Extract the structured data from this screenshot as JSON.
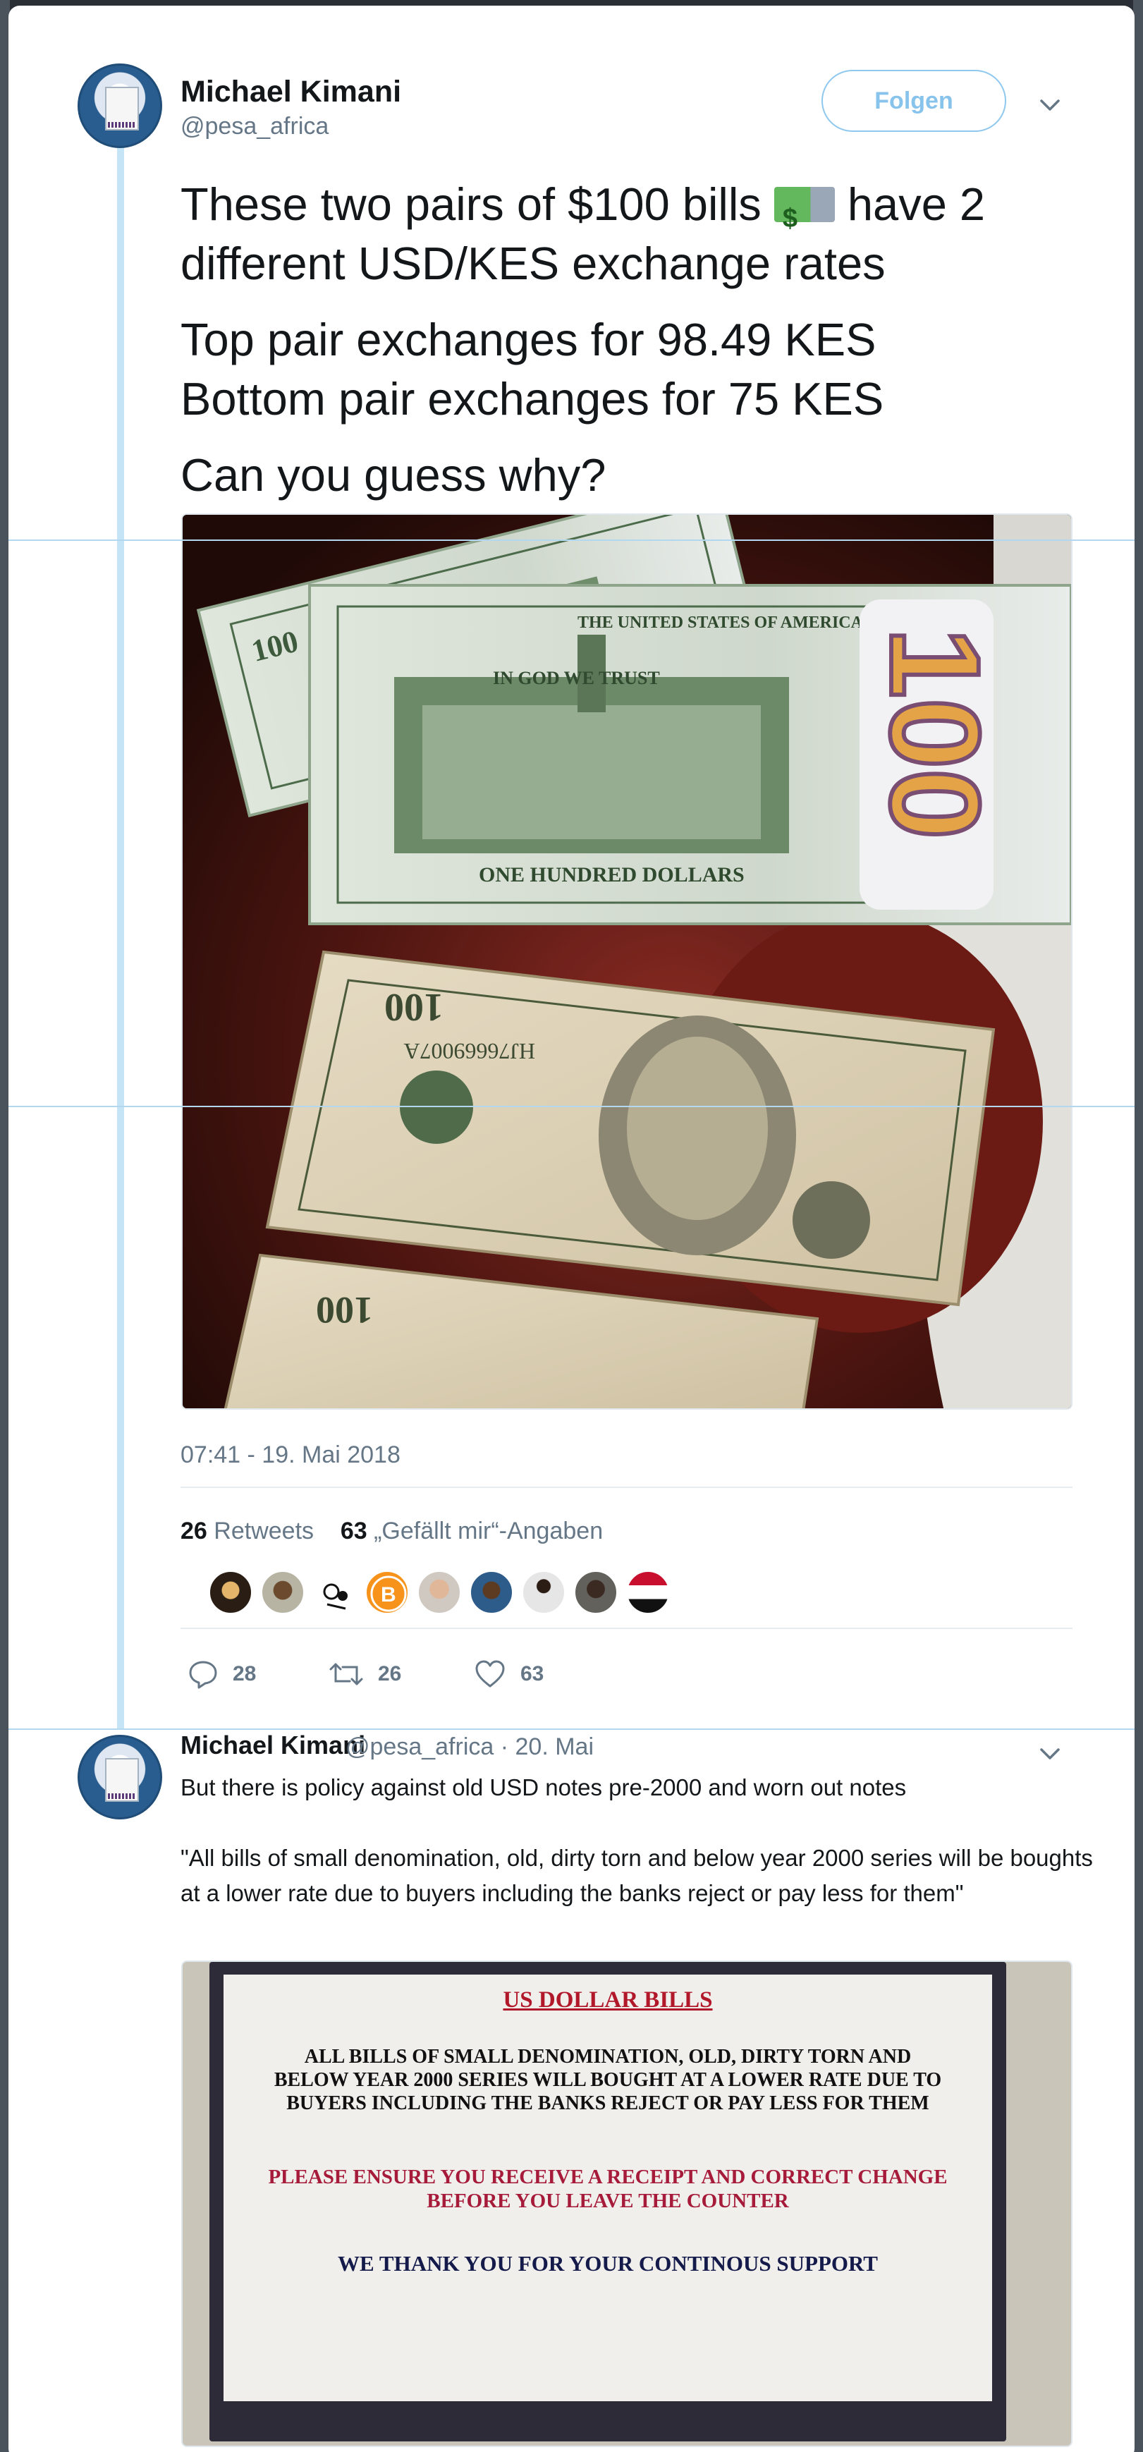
{
  "tweet": {
    "author_name": "Michael Kimani",
    "author_handle": "@pesa_africa",
    "follow_label": "Folgen",
    "text_line1_a": "These two pairs of $100 bills",
    "emoji_symbol": "$",
    "text_line1_b": "have 2",
    "text_line2": "different USD/KES exchange rates",
    "text_line3": "Top pair exchanges for 98.49 KES",
    "text_line4": "Bottom pair exchanges for 75 KES",
    "text_line5": "Can you guess why?",
    "timestamp": "07:41 - 19. Mai 2018",
    "retweet_count": "26",
    "retweet_label": "Retweets",
    "like_count": "63",
    "like_label": "„Gefällt mir“-Angaben",
    "actions": {
      "replies": "28",
      "retweets": "26",
      "likes": "63"
    },
    "photo": {
      "top_bill_text": "ONE HUNDRED DOLLARS",
      "top_bill_header": "THE UNITED STATES OF AMERICA",
      "top_bill_motto": "IN GOD WE TRUST",
      "top_bill_number": "100",
      "bottom_bill_serial": "HJ76669007A",
      "bottom_bill_number": "100"
    }
  },
  "reply": {
    "author_name": "Michael Kimani",
    "author_handle": "@pesa_africa",
    "date": "· 20. Mai",
    "line1": "But there is policy against old USD notes pre-2000 and worn out notes",
    "quote": "\"All bills of small denomination, old, dirty torn and below year 2000 series will be boughts at a lower rate due to buyers including the banks reject or pay less for them\"",
    "sign": {
      "title": "US DOLLAR BILLS",
      "body": "ALL BILLS OF SMALL DENOMINATION, OLD, DIRTY TORN AND BELOW YEAR 2000 SERIES WILL BOUGHT AT A LOWER RATE DUE TO BUYERS INCLUDING THE BANKS REJECT OR PAY LESS FOR THEM",
      "notice": "PLEASE ENSURE YOU RECEIVE A RECEIPT AND CORRECT CHANGE BEFORE YOU LEAVE THE COUNTER",
      "thanks": "WE THANK YOU FOR YOUR CONTINOUS SUPPORT"
    }
  },
  "icons": [
    "chevron-down-icon",
    "reply-icon",
    "retweet-icon",
    "like-icon"
  ],
  "colors": {
    "accent": "#1da1f2",
    "muted": "#657786",
    "thread_line": "#c5e5f7",
    "follow_border": "#8fc8ee"
  }
}
